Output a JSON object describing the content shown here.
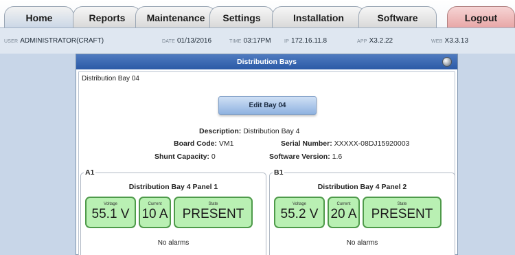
{
  "tabs": [
    {
      "label": "Home"
    },
    {
      "label": "Reports"
    },
    {
      "label": "Maintenance"
    },
    {
      "label": "Settings"
    },
    {
      "label": "Installation"
    },
    {
      "label": "Software"
    },
    {
      "label": "Logout"
    }
  ],
  "info": {
    "user_label": "USER",
    "user": "ADMINISTRATOR(CRAFT)",
    "date_label": "DATE",
    "date": "01/13/2016",
    "time_label": "TIME",
    "time": "03:17PM",
    "ip_label": "IP",
    "ip": "172.16.11.8",
    "app_label": "APP",
    "app": "X3.2.22",
    "web_label": "WEB",
    "web": "X3.3.13"
  },
  "panel": {
    "title": "Distribution Bays",
    "bay_name": "Distribution Bay 04",
    "edit_button": "Edit Bay 04",
    "description_label": "Description:",
    "description": "Distribution Bay 4",
    "board_code_label": "Board Code:",
    "board_code": "VM1",
    "serial_label": "Serial Number:",
    "serial": "XXXXX-08DJ15920003",
    "shunt_label": "Shunt Capacity:",
    "shunt": "0",
    "software_label": "Software Version:",
    "software": "1.6"
  },
  "subpanels": [
    {
      "legend": "A1",
      "title": "Distribution Bay 4 Panel 1",
      "voltage_label": "Voltage",
      "voltage": "55.1 V",
      "current_label": "Current",
      "current": "10 A",
      "state_label": "State",
      "state": "PRESENT",
      "alarms": "No alarms"
    },
    {
      "legend": "B1",
      "title": "Distribution Bay 4 Panel 2",
      "voltage_label": "Voltage",
      "voltage": "55.2 V",
      "current_label": "Current",
      "current": "20 A",
      "state_label": "State",
      "state": "PRESENT",
      "alarms": "No alarms"
    }
  ],
  "colors": {
    "title_bar": "#2b5aa6",
    "status_box_fill": "#b9f0b3",
    "status_box_border": "#4e9a4a",
    "logout_tab": "#e8a7a7"
  }
}
